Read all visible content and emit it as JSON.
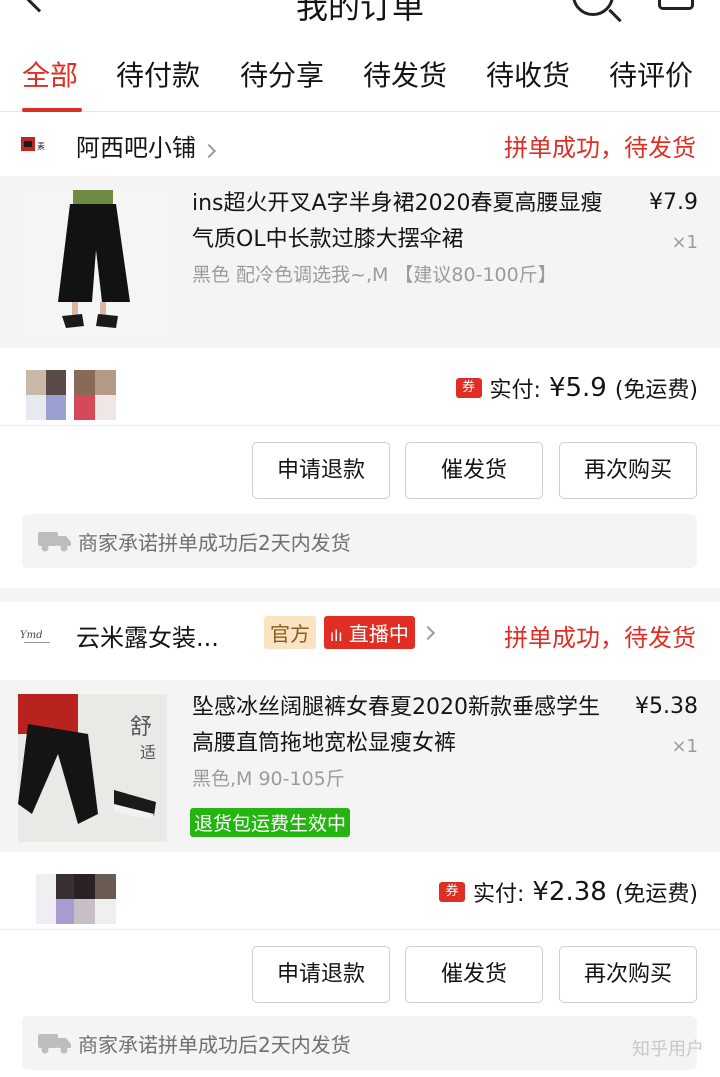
{
  "header": {
    "title": "我的订单"
  },
  "tabs": [
    {
      "label": "全部",
      "active": true
    },
    {
      "label": "待付款"
    },
    {
      "label": "待分享"
    },
    {
      "label": "待发货"
    },
    {
      "label": "待收货"
    },
    {
      "label": "待评价"
    }
  ],
  "orders": [
    {
      "shop_name": "阿西吧小铺",
      "status": "拼单成功，待发货",
      "product": {
        "title": "ins超火开叉A字半身裙2020春夏高腰显瘦气质OL中长款过膝大摆伞裙",
        "price": "¥7.9",
        "qty": "×1",
        "spec": "黑色 配冷色调选我~,M 【建议80-100斤】"
      },
      "coupon_icon": "券",
      "pay_label": "实付:",
      "pay_amount": "¥5.9",
      "shipping_note": "(免运费)",
      "buttons": [
        "申请退款",
        "催发货",
        "再次购买"
      ],
      "promise": "商家承诺拼单成功后2天内发货"
    },
    {
      "shop_name": "云米露女装...",
      "badge_official": "官方",
      "badge_live": "直播中",
      "status": "拼单成功，待发货",
      "product": {
        "title": "坠感冰丝阔腿裤女春夏2020新款垂感学生高腰直筒拖地宽松显瘦女裤",
        "price": "¥5.38",
        "qty": "×1",
        "spec": "黑色,M 90-105斤",
        "tag": "退货包运费生效中"
      },
      "coupon_icon": "券",
      "pay_label": "实付:",
      "pay_amount": "¥2.38",
      "shipping_note": "(免运费)",
      "buttons": [
        "申请退款",
        "催发货",
        "再次购买"
      ],
      "promise": "商家承诺拼单成功后2天内发货"
    }
  ],
  "watermark": "知乎用户",
  "colors": {
    "accent": "#e02e24",
    "green_tag": "#25b513",
    "muted": "#9c9c9c"
  }
}
